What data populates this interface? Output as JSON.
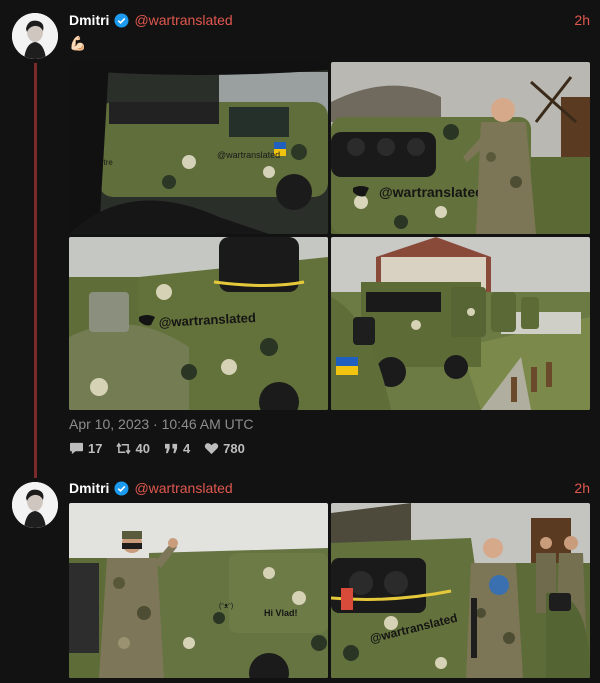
{
  "tweets": [
    {
      "author": "Dmitri",
      "handle": "@wartranslated",
      "time": "2h",
      "emoji": "💪🏻",
      "posted_at": "Apr 10, 2023 · 10:46 AM UTC",
      "stats": {
        "replies": "17",
        "retweets": "40",
        "quotes": "4",
        "likes": "780"
      },
      "images": [
        {
          "desc": "camouflage pickup seen from inside car",
          "sticker": "...itre"
        },
        {
          "desc": "soldier next to camouflage pickup",
          "sticker": "@wartranslated"
        },
        {
          "desc": "pickup truck bed side with sticker",
          "sticker": "@wartranslated"
        },
        {
          "desc": "row of camouflage pickups",
          "sticker": ""
        }
      ]
    },
    {
      "author": "Dmitri",
      "handle": "@wartranslated",
      "time": "2h",
      "images": [
        {
          "desc": "soldier with camouflage truck",
          "sticker": "Hi Vlad!"
        },
        {
          "desc": "soldiers around pickup with sticker",
          "sticker": "@wartranslated"
        }
      ]
    }
  ],
  "colors": {
    "accent": "#e0584f",
    "thread_line": "#7a2a2a",
    "verified": "#1d9bf0",
    "camo_base": "#6b7a3e"
  },
  "icons": [
    "reply-icon",
    "retweet-icon",
    "quote-icon",
    "like-icon",
    "verified-icon"
  ]
}
